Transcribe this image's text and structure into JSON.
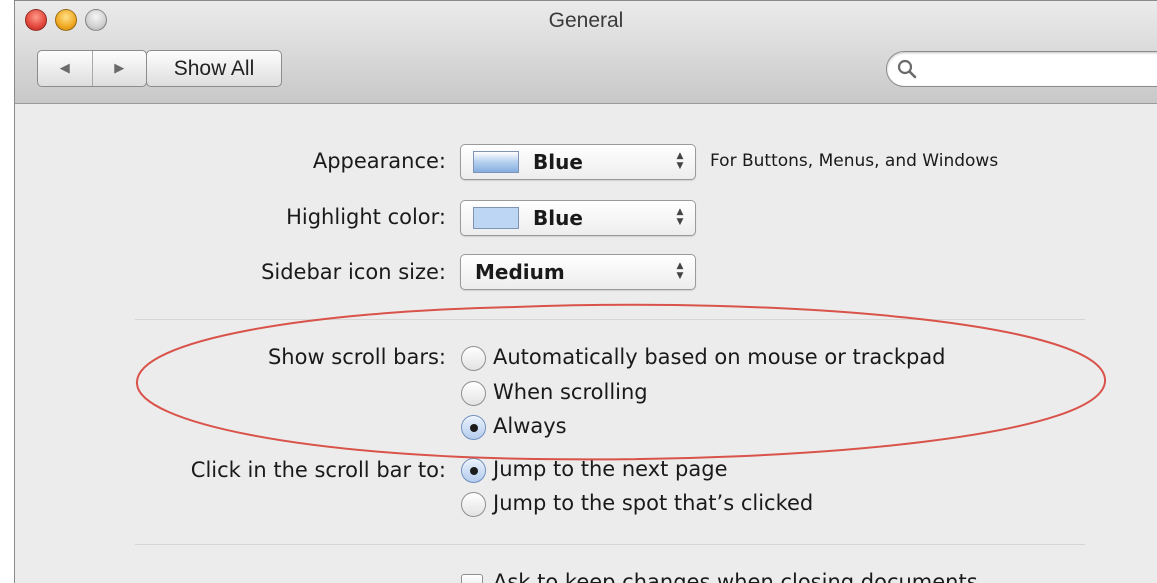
{
  "window": {
    "title": "General"
  },
  "toolbar": {
    "back_icon": "◀",
    "forward_icon": "▶",
    "show_all_label": "Show All",
    "search": {
      "value": "",
      "placeholder": ""
    }
  },
  "appearance": {
    "label": "Appearance:",
    "value": "Blue",
    "hint": "For Buttons, Menus, and Windows"
  },
  "highlight_color": {
    "label": "Highlight color:",
    "value": "Blue"
  },
  "sidebar_icon_size": {
    "label": "Sidebar icon size:",
    "value": "Medium"
  },
  "show_scroll_bars": {
    "label": "Show scroll bars:",
    "options": [
      {
        "label": "Automatically based on mouse or trackpad",
        "selected": false
      },
      {
        "label": "When scrolling",
        "selected": false
      },
      {
        "label": "Always",
        "selected": true
      }
    ]
  },
  "click_scroll_bar": {
    "label": "Click in the scroll bar to:",
    "options": [
      {
        "label": "Jump to the next page",
        "selected": true
      },
      {
        "label": "Jump to the spot that’s clicked",
        "selected": false
      }
    ]
  },
  "ask_keep_changes": {
    "label": "Ask to keep changes when closing documents",
    "checked": false
  },
  "colors": {
    "annotation_ellipse": "#d9534a",
    "window_background": "#ececec"
  }
}
